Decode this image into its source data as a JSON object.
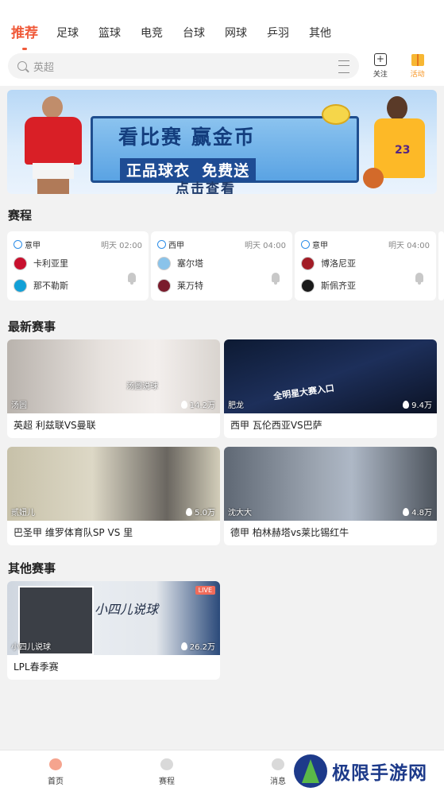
{
  "tabs": [
    {
      "label": "推荐",
      "active": true
    },
    {
      "label": "足球"
    },
    {
      "label": "篮球"
    },
    {
      "label": "电竞"
    },
    {
      "label": "台球"
    },
    {
      "label": "网球"
    },
    {
      "label": "乒羽"
    },
    {
      "label": "其他"
    }
  ],
  "search": {
    "placeholder": "英超"
  },
  "header_buttons": {
    "follow": "关注",
    "activity": "活动"
  },
  "banner": {
    "headline": "看比赛 赢金币",
    "subline_left": "正品球衣",
    "subline_right": "免费送",
    "cta": "点击查看",
    "jersey_number": "23"
  },
  "schedule": {
    "title": "赛程",
    "matches": [
      {
        "league": "意甲",
        "time": "明天 02:00",
        "home": "卡利亚里",
        "away": "那不勒斯"
      },
      {
        "league": "西甲",
        "time": "明天 04:00",
        "home": "塞尔塔",
        "away": "莱万特"
      },
      {
        "league": "意甲",
        "time": "明天 04:00",
        "home": "博洛尼亚",
        "away": "斯佩齐亚"
      }
    ]
  },
  "latest": {
    "title": "最新赛事",
    "cards": [
      {
        "author": "汤圆",
        "heat": "14.2万",
        "caption": "英超 利兹联VS曼联",
        "thumb_text": "汤圆说球"
      },
      {
        "author": "肥龙",
        "heat": "9.4万",
        "caption": "西甲 瓦伦西亚VS巴萨",
        "thumb_text": "全明星大赛入口"
      },
      {
        "author": "贰妞儿",
        "heat": "5.0万",
        "caption": "巴圣甲 维罗体育队SP VS 里"
      },
      {
        "author": "沈大大",
        "heat": "4.8万",
        "caption": "德甲 柏林赫塔vs莱比锡红牛"
      }
    ]
  },
  "other": {
    "title": "其他赛事",
    "cards": [
      {
        "author": "小四儿说球",
        "heat": "26.2万",
        "caption": "LPL春季赛",
        "thumb_text": "小四儿说球",
        "badge": "LIVE"
      }
    ]
  },
  "bottom_nav": [
    {
      "label": "首页",
      "active": true
    },
    {
      "label": "赛程"
    },
    {
      "label": "消息"
    }
  ],
  "watermark": "极限手游网",
  "colors": {
    "accent": "#f05a3a",
    "background": "#f2f2f2"
  }
}
